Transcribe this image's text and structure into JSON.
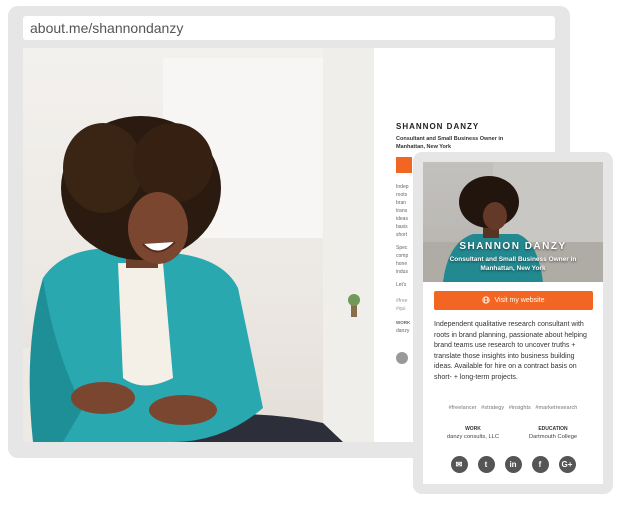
{
  "browser": {
    "url": "about.me/shannondanzy"
  },
  "desktop_profile": {
    "name": "SHANNON DANZY",
    "headline": "Consultant and Small Business Owner in Manhattan, New York",
    "bio_lines": [
      "Indep",
      "roots",
      "bran",
      "trans",
      "ideas",
      "basis",
      "short"
    ],
    "bio_lines_2": [
      "Spec",
      "comp",
      "hone",
      "indus"
    ],
    "lets": "Let's",
    "tags": [
      "#free",
      "#qui"
    ],
    "work_label": "WORK",
    "work_value": "danzy"
  },
  "mobile_profile": {
    "name": "SHANNON DANZY",
    "headline": "Consultant and Small Business Owner in Manhattan, New York",
    "cta_label": "Visit my website",
    "bio": "Independent qualitative research consultant with roots in brand planning, passionate about helping brand teams use research to uncover truths + translate those insights into business building ideas. Available for hire on a contract basis on short- + long-term projects.",
    "tags": [
      "#freelancer",
      "#strategy",
      "#insights",
      "#marketresearch"
    ],
    "work_label": "WORK",
    "work_value": "danzy consults, LLC",
    "education_label": "EDUCATION",
    "education_value": "Dartmouth College",
    "social_icons": [
      {
        "name": "email-icon",
        "glyph": "✉"
      },
      {
        "name": "twitter-icon",
        "glyph": "t"
      },
      {
        "name": "linkedin-icon",
        "glyph": "in"
      },
      {
        "name": "facebook-icon",
        "glyph": "f"
      },
      {
        "name": "google-plus-icon",
        "glyph": "G+"
      }
    ]
  },
  "colors": {
    "accent": "#f26522",
    "frame": "#e6e6e6",
    "blazer": "#2aa8b0"
  }
}
